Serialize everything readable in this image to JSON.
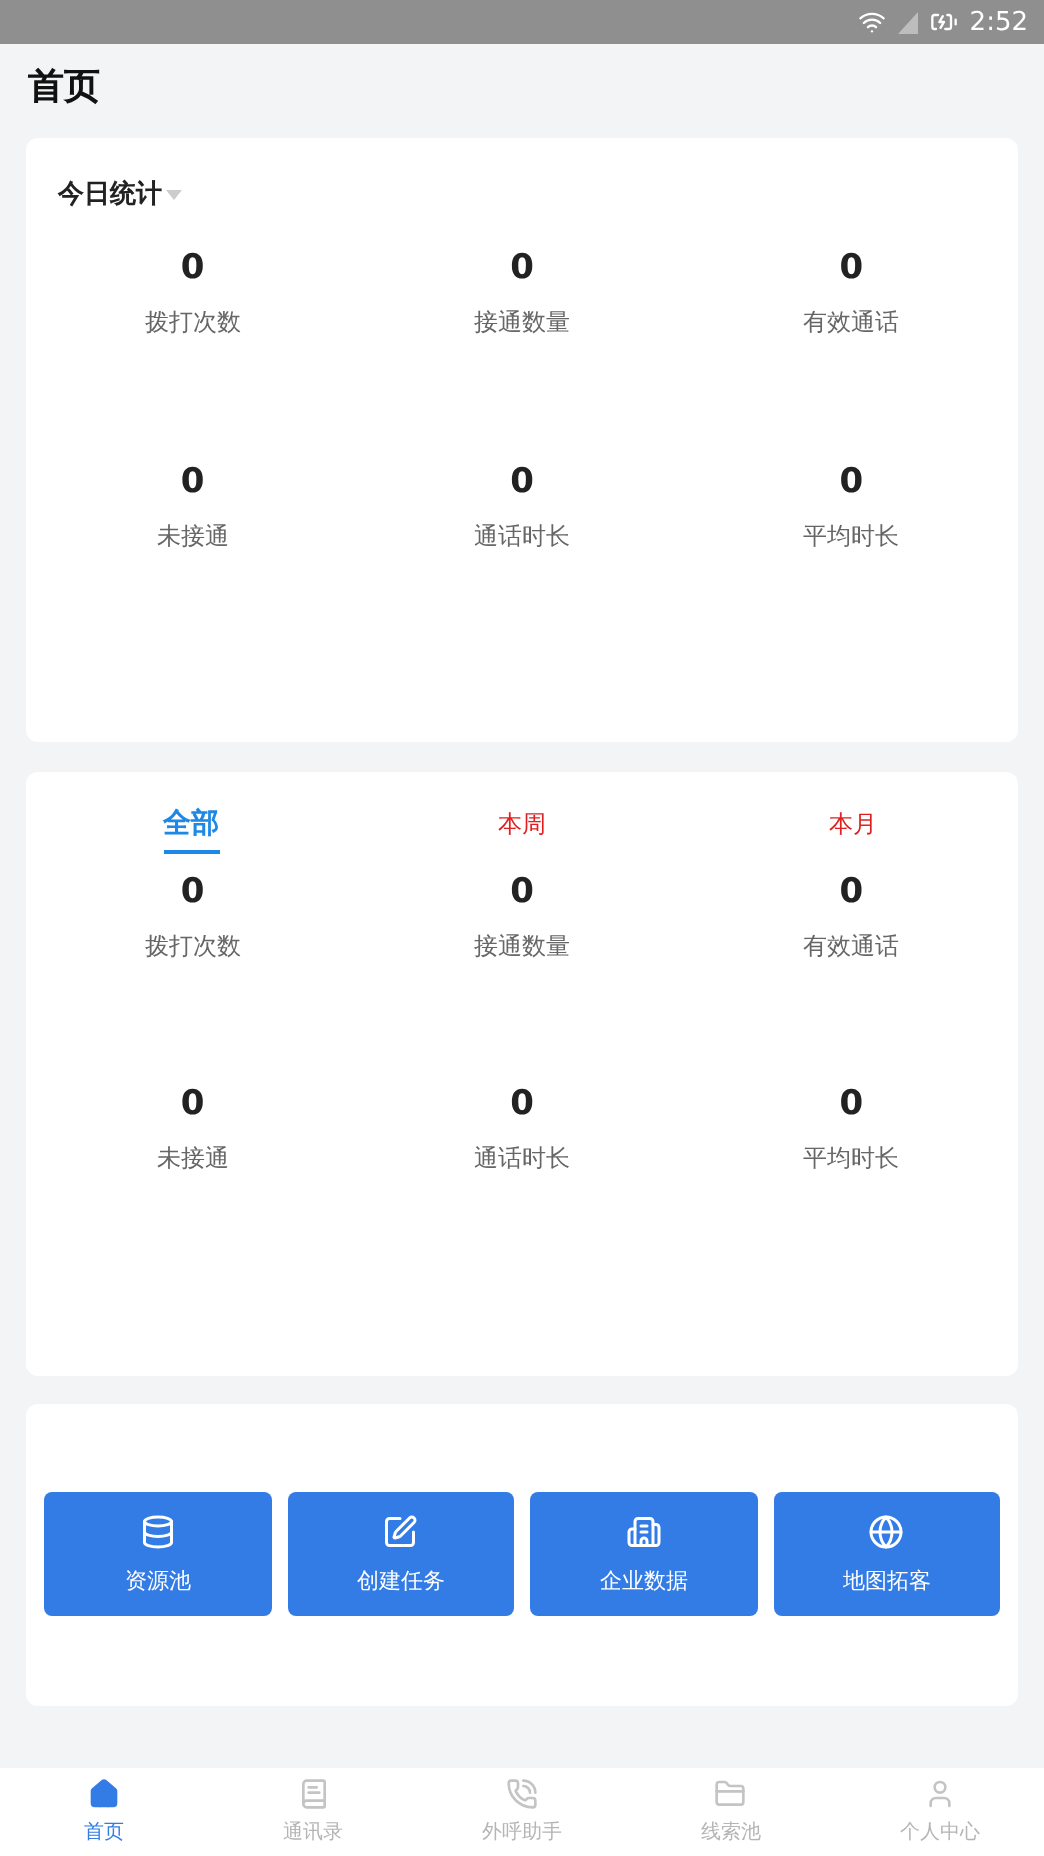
{
  "status_bar": {
    "time": "2:52"
  },
  "page_title": "首页",
  "today_card": {
    "title": "今日统计",
    "stats": [
      {
        "value": "0",
        "label": "拨打次数"
      },
      {
        "value": "0",
        "label": "接通数量"
      },
      {
        "value": "0",
        "label": "有效通话"
      },
      {
        "value": "0",
        "label": "未接通"
      },
      {
        "value": "0",
        "label": "通话时长"
      },
      {
        "value": "0",
        "label": "平均时长"
      }
    ]
  },
  "period_card": {
    "tabs": [
      {
        "label": "全部",
        "selected": true
      },
      {
        "label": "本周",
        "selected": false
      },
      {
        "label": "本月",
        "selected": false
      }
    ],
    "stats": [
      {
        "value": "0",
        "label": "拨打次数"
      },
      {
        "value": "0",
        "label": "接通数量"
      },
      {
        "value": "0",
        "label": "有效通话"
      },
      {
        "value": "0",
        "label": "未接通"
      },
      {
        "value": "0",
        "label": "通话时长"
      },
      {
        "value": "0",
        "label": "平均时长"
      }
    ]
  },
  "actions": [
    {
      "kind": "database",
      "label": "资源池"
    },
    {
      "kind": "edit",
      "label": "创建任务"
    },
    {
      "kind": "building",
      "label": "企业数据"
    },
    {
      "kind": "globe",
      "label": "地图拓客"
    }
  ],
  "bottom_nav": [
    {
      "kind": "home",
      "label": "首页",
      "selected": true
    },
    {
      "kind": "book",
      "label": "通讯录",
      "selected": false
    },
    {
      "kind": "phone",
      "label": "外呼助手",
      "selected": false
    },
    {
      "kind": "folder",
      "label": "线索池",
      "selected": false
    },
    {
      "kind": "user",
      "label": "个人中心",
      "selected": false
    }
  ]
}
